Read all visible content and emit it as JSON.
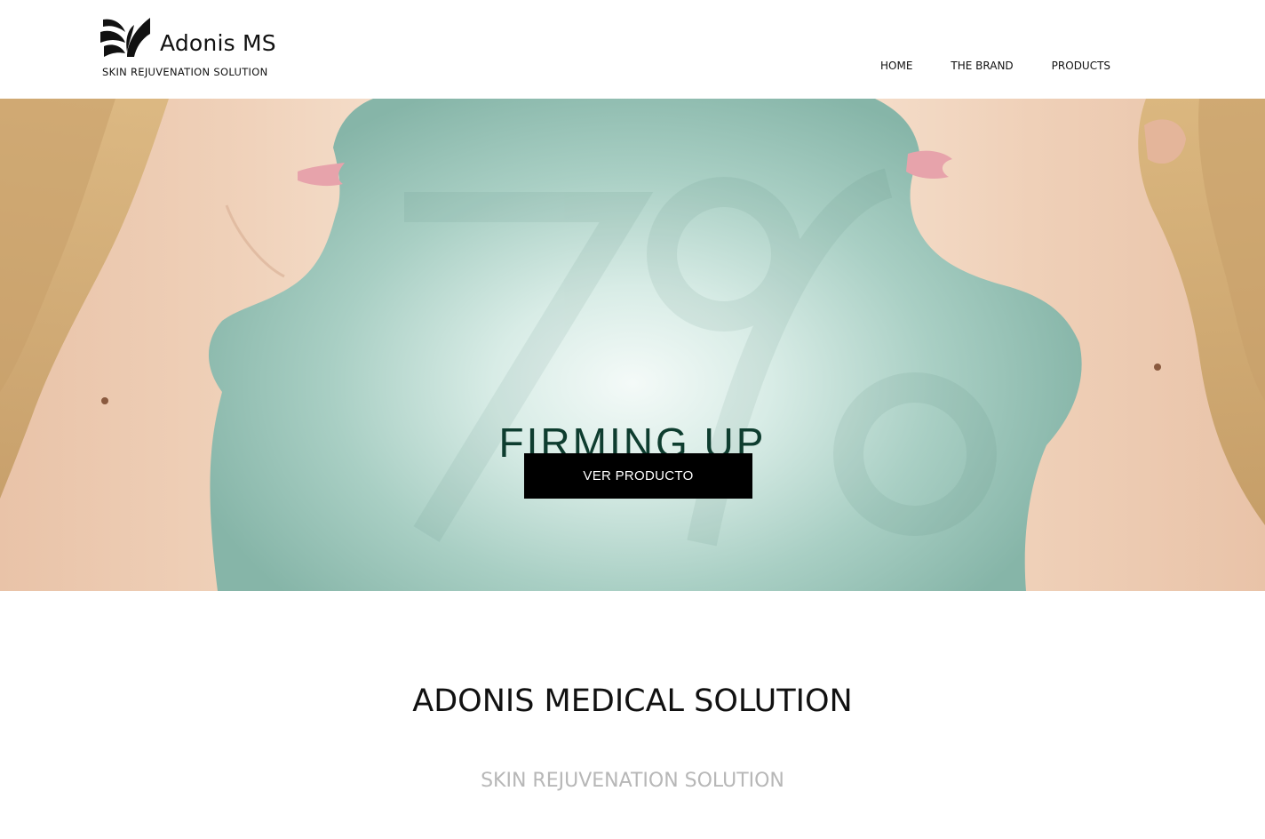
{
  "header": {
    "logo_name": "Adonis MS",
    "logo_tagline": "SKIN REJUVENATION SOLUTION",
    "nav": [
      {
        "label": "HOME"
      },
      {
        "label": "THE BRAND"
      },
      {
        "label": "PRODUCTS"
      }
    ]
  },
  "hero": {
    "title": "FIRMING UP",
    "watermark": "7%",
    "button_label": "VER PRODUCTO",
    "background_color": "#a9cfc4",
    "title_color": "#0e3d2f"
  },
  "about": {
    "title": "ADONIS MEDICAL SOLUTION",
    "subtitle": "SKIN REJUVENATION SOLUTION"
  },
  "icons": [
    "adonis-logo-icon"
  ]
}
